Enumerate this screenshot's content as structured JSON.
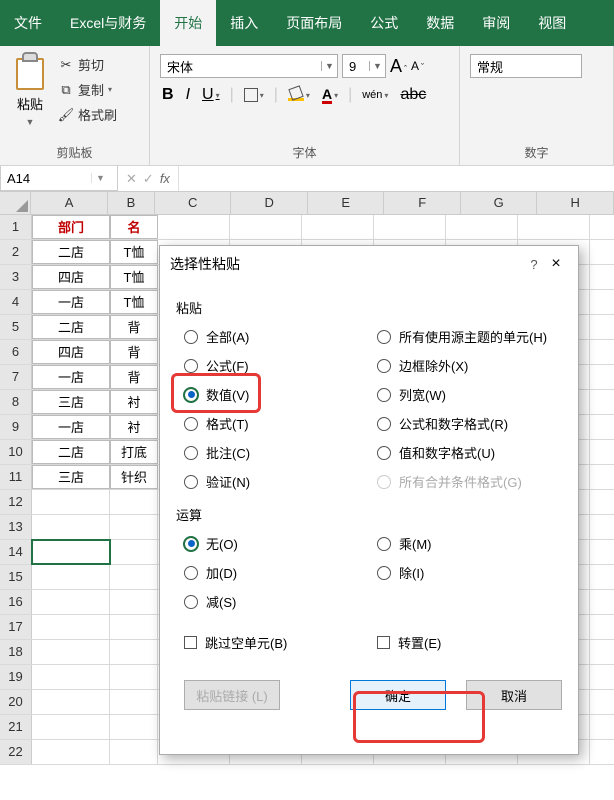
{
  "menubar": {
    "tabs": [
      "文件",
      "Excel与财务",
      "开始",
      "插入",
      "页面布局",
      "公式",
      "数据",
      "审阅",
      "视图"
    ],
    "active": 2
  },
  "clipboard": {
    "paste": "粘贴",
    "cut": "剪切",
    "copy": "复制",
    "format_painter": "格式刷",
    "group_label": "剪贴板"
  },
  "font": {
    "name": "宋体",
    "size": "9",
    "bold": "B",
    "italic": "I",
    "underline": "U",
    "strike": "abc",
    "wen": "wén",
    "group_label": "字体",
    "fontcolor_letter": "A"
  },
  "number": {
    "format": "常规",
    "group_label": "数字"
  },
  "namebox": "A14",
  "columns": [
    "A",
    "B",
    "C",
    "D",
    "E",
    "F",
    "G",
    "H"
  ],
  "rows": [
    {
      "n": 1,
      "a": "部门",
      "b": "名"
    },
    {
      "n": 2,
      "a": "二店",
      "b": "T恤"
    },
    {
      "n": 3,
      "a": "四店",
      "b": "T恤"
    },
    {
      "n": 4,
      "a": "一店",
      "b": "T恤"
    },
    {
      "n": 5,
      "a": "二店",
      "b": "背"
    },
    {
      "n": 6,
      "a": "四店",
      "b": "背"
    },
    {
      "n": 7,
      "a": "一店",
      "b": "背"
    },
    {
      "n": 8,
      "a": "三店",
      "b": "衬"
    },
    {
      "n": 9,
      "a": "一店",
      "b": "衬"
    },
    {
      "n": 10,
      "a": "二店",
      "b": "打底"
    },
    {
      "n": 11,
      "a": "三店",
      "b": "针织"
    },
    {
      "n": 12,
      "a": "",
      "b": ""
    },
    {
      "n": 13,
      "a": "",
      "b": ""
    },
    {
      "n": 14,
      "a": "",
      "b": ""
    },
    {
      "n": 15,
      "a": "",
      "b": ""
    },
    {
      "n": 16,
      "a": "",
      "b": ""
    },
    {
      "n": 17,
      "a": "",
      "b": ""
    },
    {
      "n": 18,
      "a": "",
      "b": ""
    },
    {
      "n": 19,
      "a": "",
      "b": ""
    },
    {
      "n": 20,
      "a": "",
      "b": ""
    },
    {
      "n": 21,
      "a": "",
      "b": ""
    },
    {
      "n": 22,
      "a": "",
      "b": ""
    }
  ],
  "dialog": {
    "title": "选择性粘贴",
    "help": "?",
    "close": "×",
    "sect_paste": "粘贴",
    "paste_left": [
      "全部(A)",
      "公式(F)",
      "数值(V)",
      "格式(T)",
      "批注(C)",
      "验证(N)"
    ],
    "paste_right": [
      "所有使用源主题的单元(H)",
      "边框除外(X)",
      "列宽(W)",
      "公式和数字格式(R)",
      "值和数字格式(U)",
      "所有合并条件格式(G)"
    ],
    "paste_selected": 2,
    "sect_op": "运算",
    "op_left": [
      "无(O)",
      "加(D)",
      "减(S)"
    ],
    "op_right": [
      "乘(M)",
      "除(I)"
    ],
    "op_selected": 0,
    "skip_blanks": "跳过空单元(B)",
    "transpose": "转置(E)",
    "paste_link": "粘贴链接 (L)",
    "ok": "确定",
    "cancel": "取消"
  }
}
